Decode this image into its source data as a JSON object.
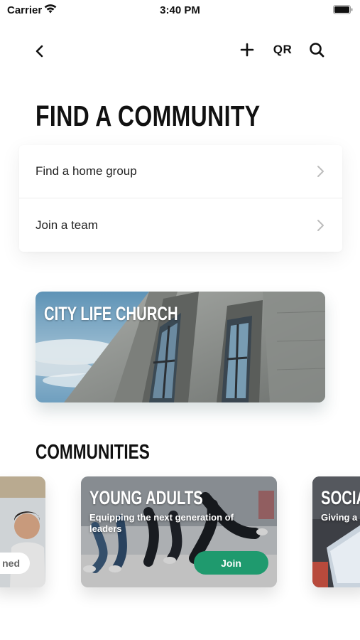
{
  "status_bar": {
    "carrier": "Carrier",
    "time": "3:40 PM"
  },
  "nav": {
    "back_icon": "chevron-left-icon",
    "add_icon": "plus-icon",
    "qr_label": "QR",
    "search_icon": "search-icon"
  },
  "page": {
    "title": "FIND A COMMUNITY"
  },
  "menu": {
    "items": [
      {
        "label": "Find a home group"
      },
      {
        "label": "Join a team"
      }
    ]
  },
  "church": {
    "name": "CITY LIFE CHURCH"
  },
  "communities": {
    "heading": "COMMUNITIES",
    "cards": [
      {
        "title": "",
        "description": "",
        "button": "ned"
      },
      {
        "title": "YOUNG ADULTS",
        "description": "Equipping the next generation of leaders",
        "button": "Join"
      },
      {
        "title": "SOCIAL",
        "description": "Giving a"
      }
    ]
  },
  "colors": {
    "accent": "#1f9a6e",
    "text": "#111111"
  }
}
